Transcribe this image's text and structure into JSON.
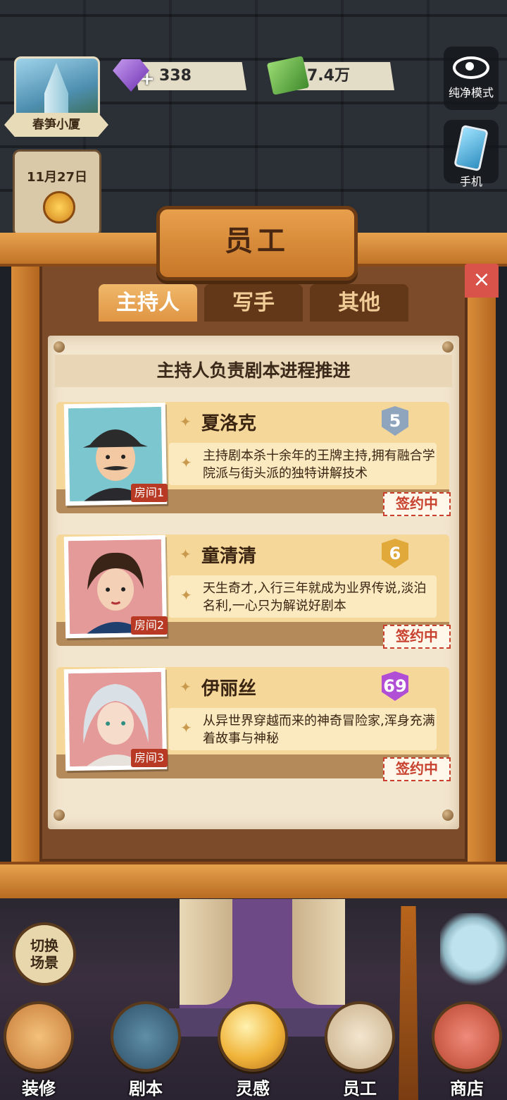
{
  "hud": {
    "building_name": "春笋小厦",
    "gems": "338",
    "cash": "7.4万",
    "date": "11月27日",
    "plus": "+",
    "side_buttons": [
      {
        "label": "纯净模式",
        "icon": "eye-icon"
      },
      {
        "label": "手机",
        "icon": "phone-icon"
      }
    ]
  },
  "panel": {
    "title": "员工",
    "close": "×",
    "tabs": [
      {
        "label": "主持人",
        "active": true
      },
      {
        "label": "写手",
        "active": false
      },
      {
        "label": "其他",
        "active": false
      }
    ],
    "subtitle": "主持人负责剧本进程推进"
  },
  "staff": [
    {
      "name": "夏洛克",
      "level": "5",
      "level_color": "#8fa4bd",
      "desc": "主持剧本杀十余年的王牌主持,拥有融合学院派与街头派的独特讲解技术",
      "room": "房间1",
      "status": "签约中",
      "portrait_bg": "#7cc6cf"
    },
    {
      "name": "童清清",
      "level": "6",
      "level_color": "#e1a83a",
      "desc": "天生奇才,入行三年就成为业界传说,淡泊名利,一心只为解说好剧本",
      "room": "房间2",
      "status": "签约中",
      "portrait_bg": "#e59a9a"
    },
    {
      "name": "伊丽丝",
      "level": "69",
      "level_color": "#b04fd6",
      "desc": "从异世界穿越而来的神奇冒险家,浑身充满着故事与神秘",
      "room": "房间3",
      "status": "签约中",
      "portrait_bg": "#e59a9a"
    }
  ],
  "bottom_nav": {
    "switch_scene": "切换场景",
    "items": [
      {
        "label": "装修",
        "icon": "house-icon"
      },
      {
        "label": "剧本",
        "icon": "script-book-icon"
      },
      {
        "label": "灵感",
        "icon": "inspiration-orb-icon"
      },
      {
        "label": "员工",
        "icon": "staff-badge-icon"
      },
      {
        "label": "商店",
        "icon": "shop-icon"
      }
    ]
  },
  "colors": {
    "wood": "#c77727",
    "paper": "#f3e6cf",
    "tab_active": "#df9543",
    "sign_red": "#c8412f"
  }
}
